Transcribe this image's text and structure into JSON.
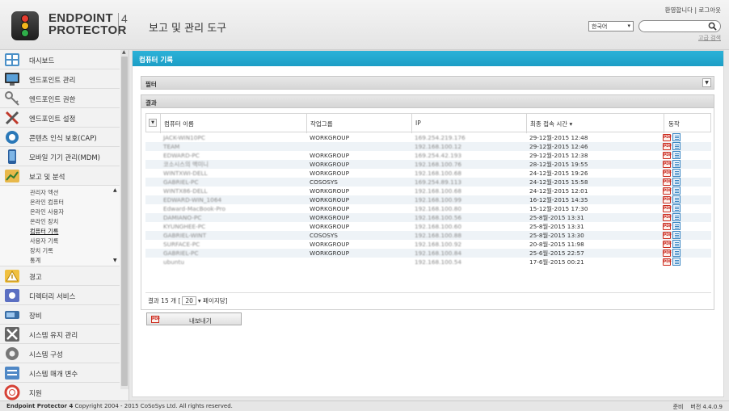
{
  "header": {
    "logo_line1": "ENDPOINT",
    "logo_line2": "PROTECTOR",
    "logo_version": "4",
    "app_title": "보고 및 관리 도구",
    "welcome": "환영합니다",
    "logout": "로그아웃",
    "language": "한국어",
    "search_value": "",
    "advanced_search": "고급 검색"
  },
  "sidebar": {
    "items": [
      {
        "label": "대시보드",
        "icon": "dashboard-icon"
      },
      {
        "label": "엔드포인트 관리",
        "icon": "monitor-icon"
      },
      {
        "label": "엔드포인트 권한",
        "icon": "keys-icon"
      },
      {
        "label": "엔드포인트 설정",
        "icon": "tools-icon"
      },
      {
        "label": "콘텐츠 인식 보호(CAP)",
        "icon": "content-aware-icon"
      },
      {
        "label": "모바일 기기 관리(MDM)",
        "icon": "mobile-icon"
      },
      {
        "label": "보고 및 분석",
        "icon": "chart-icon"
      }
    ],
    "sub_items": [
      "관리자 액션",
      "온라인 컴퓨터",
      "온라인 사용자",
      "온라인 장치",
      "컴퓨터 기록",
      "사용자 기록",
      "장치 기록",
      "통계"
    ],
    "active_sub": "컴퓨터 기록",
    "items_bottom": [
      {
        "label": "경고",
        "icon": "warning-icon"
      },
      {
        "label": "디렉터리 서비스",
        "icon": "directory-icon"
      },
      {
        "label": "장비",
        "icon": "hardware-icon"
      },
      {
        "label": "시스템 유지 관리",
        "icon": "maintenance-icon"
      },
      {
        "label": "시스템 구성",
        "icon": "config-icon"
      },
      {
        "label": "시스템 매개 변수",
        "icon": "parameters-icon"
      },
      {
        "label": "지원",
        "icon": "support-icon"
      }
    ]
  },
  "main": {
    "title": "컴퓨터 기록",
    "filter_label": "필터",
    "results_label": "결과",
    "columns": [
      "컴퓨터 이름",
      "작업그룹",
      "IP",
      "최종 접속 시간 ▾",
      "동작"
    ],
    "rows": [
      {
        "name": "JACK-WIN10PC",
        "group": "WORKGROUP",
        "ip": "169.254.219.176",
        "time": "29-12월-2015 12:48"
      },
      {
        "name": "TEAM",
        "group": "",
        "ip": "192.168.100.12",
        "time": "29-12월-2015 12:46"
      },
      {
        "name": "EDWARD-PC",
        "group": "WORKGROUP",
        "ip": "169.254.42.193",
        "time": "29-12월-2015 12:38"
      },
      {
        "name": "코소시스의 맥미니",
        "group": "WORKGROUP",
        "ip": "192.168.100.76",
        "time": "28-12월-2015 19:55"
      },
      {
        "name": "WINTXWI-DELL",
        "group": "WORKGROUP",
        "ip": "192.168.100.68",
        "time": "24-12월-2015 19:26"
      },
      {
        "name": "GABRIEL-PC",
        "group": "COSOSYS",
        "ip": "169.254.89.113",
        "time": "24-12월-2015 15:58"
      },
      {
        "name": "WINTX86-DELL",
        "group": "WORKGROUP",
        "ip": "192.168.100.68",
        "time": "24-12월-2015 12:01"
      },
      {
        "name": "EDWARD-WIN_1064",
        "group": "WORKGROUP",
        "ip": "192.168.100.99",
        "time": "16-12월-2015 14:35"
      },
      {
        "name": "Edward-MacBook-Pro",
        "group": "WORKGROUP",
        "ip": "192.168.100.80",
        "time": "15-12월-2015 17:30"
      },
      {
        "name": "DAMIANO-PC",
        "group": "WORKGROUP",
        "ip": "192.168.100.56",
        "time": "25-8월-2015 13:31"
      },
      {
        "name": "KYUNGHEE-PC",
        "group": "WORKGROUP",
        "ip": "192.168.100.60",
        "time": "25-8월-2015 13:31"
      },
      {
        "name": "GABRIEL-WINT",
        "group": "COSOSYS",
        "ip": "192.168.100.88",
        "time": "25-8월-2015 13:30"
      },
      {
        "name": "SURFACE-PC",
        "group": "WORKGROUP",
        "ip": "192.168.100.92",
        "time": "20-8월-2015 11:98"
      },
      {
        "name": "GABRIEL-PC",
        "group": "WORKGROUP",
        "ip": "192.168.100.84",
        "time": "25-6월-2015 22:57"
      },
      {
        "name": "ubuntu",
        "group": "",
        "ip": "192.168.100.54",
        "time": "17-6월-2015 00:21"
      }
    ],
    "pager_prefix": "결과 15 개",
    "page_size": "20",
    "pager_suffix": "페이지당",
    "export_label": "내보내기"
  },
  "footer": {
    "brand": "Endpoint Protector 4",
    "copyright": "Copyright 2004 - 2015 CoSoSys Ltd. All rights reserved.",
    "status": "준비",
    "version": "버전 4.4.0.9"
  },
  "colors": {
    "accent": "#1ea7cf",
    "row_alt": "#eef3f7"
  }
}
